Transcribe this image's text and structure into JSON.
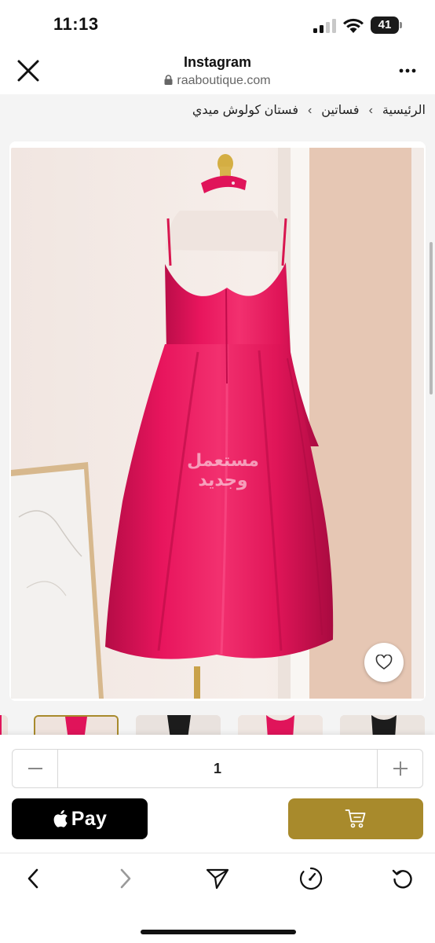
{
  "status_bar": {
    "time": "11:13",
    "battery_level": "41",
    "icons": [
      "cellular-signal-icon",
      "wifi-icon",
      "battery-icon"
    ]
  },
  "browser": {
    "title": "Instagram",
    "url": "raaboutique.com",
    "icons": [
      "close-icon",
      "lock-icon",
      "more-icon"
    ]
  },
  "breadcrumb": {
    "items": [
      "الرئيسية",
      "فساتين",
      "فستان كولوش ميدي"
    ],
    "separator": "›"
  },
  "product": {
    "watermark_line1": "مستعمل",
    "watermark_line2": "وجديد",
    "image_subject": "pink satin midi dress on mannequin",
    "dress_color": "#e8155d"
  },
  "purchase": {
    "quantity": "1",
    "apple_pay_label": "Pay",
    "accent_color": "#a88a2c",
    "icons": [
      "minus-icon",
      "plus-icon",
      "apple-logo-icon",
      "cart-icon"
    ]
  },
  "toolbar": {
    "icons": [
      "back-icon",
      "forward-icon",
      "share-icon",
      "speed-icon",
      "reload-icon"
    ]
  }
}
